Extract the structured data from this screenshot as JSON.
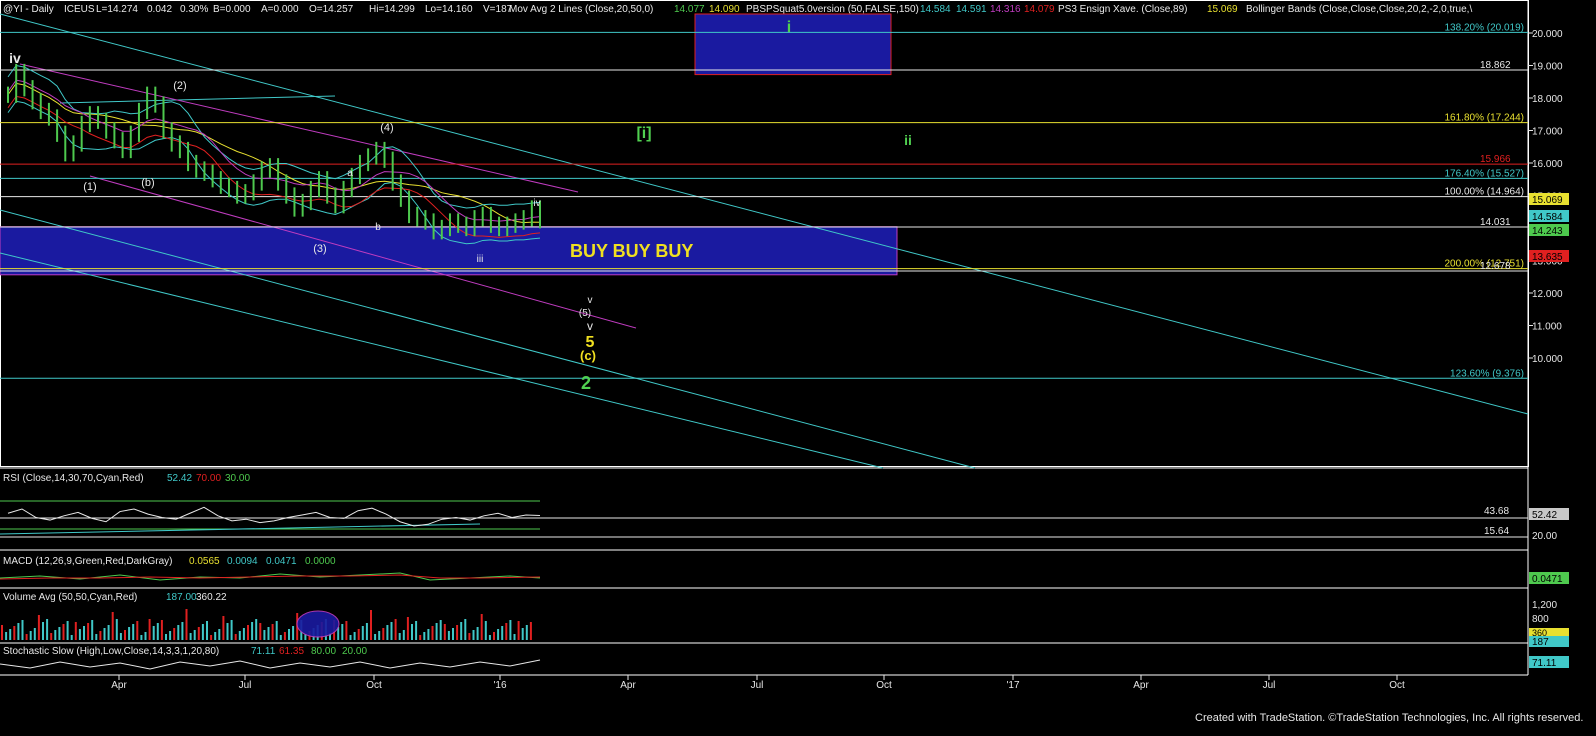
{
  "header": {
    "symbol": "@YI - Daily",
    "exchange": "ICEUS",
    "last": "L=14.274",
    "change": "0.042",
    "pct": "0.30%",
    "bid": "B=0.000",
    "ask": "A=0.000",
    "open": "O=14.257",
    "high": "Hi=14.299",
    "low": "Lo=14.160",
    "vol": "V=187",
    "ma_label": "Mov Avg 2 Lines (Close,20,50,0)",
    "ma_v1": "14.077",
    "ma_v2": "14.090",
    "pbs_label": "PBSPSquat5.0version (50,FALSE,150)",
    "pbs_v1": "14.584",
    "pbs_v2": "14.591",
    "pbs_v3": "14.316",
    "pbs_v4": "14.079",
    "xave_label": "PS3 Ensign Xave. (Close,89)",
    "xave_v": "15.069",
    "bb_label": "Bollinger Bands (Close,Close,Close,20,2,-2,0,true,\\"
  },
  "colors": {
    "background": "#000000",
    "price_bar": "#4ec94e",
    "cyan": "#40c8c8",
    "magenta": "#c03cc0",
    "red": "#e02020",
    "yellow": "#e8e030",
    "blue_box": "#1a1aa0",
    "label_green": "#50d050",
    "label_yellow": "#f0e020"
  },
  "chart_data": [
    {
      "type": "line",
      "panel": "price",
      "title": "@YI - Daily ICEUS",
      "ylim": [
        9.1,
        20.5
      ],
      "y_ticks": [
        "20.000",
        "19.000",
        "18.000",
        "17.000",
        "16.000",
        "15.000",
        "14.000",
        "13.000",
        "12.000",
        "11.000",
        "10.000"
      ],
      "x_ticks": [
        "Apr",
        "Jul",
        "Oct",
        "'16",
        "Apr",
        "Jul",
        "Oct",
        "'17",
        "Apr",
        "Jul",
        "Oct"
      ],
      "last_price": 14.243,
      "price_tags": [
        {
          "value": "15.069",
          "color": "#e8e030"
        },
        {
          "value": "14.584",
          "color": "#40c8c8"
        },
        {
          "value": "14.243",
          "color": "#4ec94e"
        },
        {
          "value": "13.635",
          "color": "#e02020"
        }
      ],
      "levels": [
        {
          "label": "138.20% (20.019)",
          "value": 20.019,
          "color": "#40c8c8"
        },
        {
          "label": "18.862",
          "value": 18.862,
          "color": "#e8e8e8"
        },
        {
          "label": "161.80% (17.244)",
          "value": 17.244,
          "color": "#e8e030"
        },
        {
          "label": "15.966",
          "value": 15.966,
          "color": "#e02020"
        },
        {
          "label": "176.40% (15.527)",
          "value": 15.527,
          "color": "#40c8c8"
        },
        {
          "label": "100.00% (14.964)",
          "value": 14.964,
          "color": "#e8e8e8"
        },
        {
          "label": "14.031",
          "value": 14.031,
          "color": "#e8e8e8"
        },
        {
          "label": "200.00% (12.751)",
          "value": 12.751,
          "color": "#e8e030"
        },
        {
          "label": "12.678",
          "value": 12.678,
          "color": "#e8e8e8"
        },
        {
          "label": "123.60% (9.376)",
          "value": 9.376,
          "color": "#40c8c8"
        }
      ],
      "zones": [
        {
          "label": "BUY BUY BUY",
          "from": 12.56,
          "to": 14.04
        },
        {
          "label": "i",
          "from": 18.72,
          "to": 20.5
        }
      ],
      "wave_labels": [
        {
          "text": "iv",
          "color": "#e8e8e8"
        },
        {
          "text": "(1)",
          "color": "#e8e8e8"
        },
        {
          "text": "(b)",
          "color": "#e8e8e8"
        },
        {
          "text": "(2)",
          "color": "#e8e8e8"
        },
        {
          "text": "(3)",
          "color": "#e8e8e8"
        },
        {
          "text": "(4)",
          "color": "#e8e8e8"
        },
        {
          "text": "a",
          "color": "#e8e8e8"
        },
        {
          "text": "b",
          "color": "#e8e8e8"
        },
        {
          "text": "iii",
          "color": "#e8e8e8"
        },
        {
          "text": "iv",
          "color": "#e8e8e8"
        },
        {
          "text": "v",
          "color": "#e8e8e8"
        },
        {
          "text": "(5)",
          "color": "#e8e8e8"
        },
        {
          "text": "v",
          "color": "#e8e8e8"
        },
        {
          "text": "5",
          "color": "#f0e020"
        },
        {
          "text": "(c)",
          "color": "#f0e020"
        },
        {
          "text": "2",
          "color": "#50d050"
        },
        {
          "text": "[i]",
          "color": "#50d050"
        },
        {
          "text": "ii",
          "color": "#50d050"
        },
        {
          "text": "i",
          "color": "#50d050"
        }
      ],
      "series": [
        {
          "name": "@YI",
          "values": [
            18.1,
            18.8,
            18.3,
            17.9,
            17.6,
            17.4,
            16.9,
            16.3,
            16.6,
            17.2,
            17.5,
            17.3,
            17.0,
            16.7,
            16.4,
            16.9,
            17.6,
            18.1,
            17.8,
            17.0,
            16.6,
            16.4,
            16.0,
            15.8,
            15.7,
            15.5,
            15.3,
            15.2,
            15.0,
            15.1,
            15.4,
            15.8,
            15.9,
            15.4,
            15.0,
            14.6,
            14.8,
            15.2,
            15.5,
            15.0,
            14.7,
            15.2,
            15.6,
            16.0,
            16.2,
            16.4,
            16.1,
            15.4,
            14.9,
            14.4,
            14.3,
            14.2,
            13.9,
            14.0,
            14.2,
            14.1,
            14.0,
            14.3,
            14.4,
            14.1,
            14.0,
            14.1,
            14.2,
            14.3,
            14.6,
            14.24
          ]
        }
      ]
    },
    {
      "type": "line",
      "panel": "rsi",
      "title": "RSI (Close,14,30,70,Cyan,Red)",
      "values_label": [
        "52.42",
        "70.00",
        "30.00"
      ],
      "levels": [
        "43.68",
        "15.64"
      ],
      "y_ticks": [
        "20.00"
      ],
      "last": "52.42",
      "series": [
        {
          "name": "RSI",
          "values": [
            55,
            60,
            50,
            47,
            52,
            56,
            49,
            45,
            57,
            60,
            54,
            50,
            48,
            55,
            62,
            52,
            46,
            48,
            44,
            46,
            50,
            53,
            56,
            50,
            49,
            58,
            61,
            54,
            45,
            40,
            42,
            48,
            50,
            47,
            52,
            55,
            50,
            53,
            52.4
          ]
        }
      ]
    },
    {
      "type": "line",
      "panel": "macd",
      "title": "MACD (12,26,9,Green,Red,DarkGray)",
      "values_label": [
        "0.0565",
        "0.0094",
        "0.0471",
        "0.0000"
      ],
      "last": "0.0471"
    },
    {
      "type": "bar",
      "panel": "volume",
      "title": "Volume Avg (50,50,Cyan,Red)",
      "values_label": [
        "187.00",
        "360.22"
      ],
      "y_ticks": [
        "1,200",
        "800"
      ],
      "tags": [
        "360",
        "187"
      ]
    },
    {
      "type": "line",
      "panel": "stochastic",
      "title": "Stochastic Slow (High,Low,Close,14,3,3,1,20,80)",
      "values_label": [
        "71.11",
        "61.35",
        "80.00",
        "20.00"
      ],
      "last": "71.11"
    }
  ],
  "footer": "Created with TradeStation. ©TradeStation Technologies, Inc. All rights reserved."
}
